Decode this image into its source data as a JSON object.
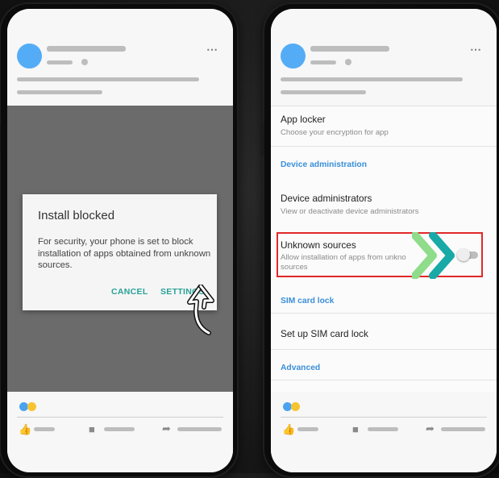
{
  "left_phone": {
    "more_icon": "⋯",
    "dialog": {
      "title": "Install blocked",
      "body": "For security, your phone is set to block installation of apps obtained from unknown sources.",
      "cancel_label": "CANCEL",
      "settings_label": "SETTINGS"
    }
  },
  "right_phone": {
    "more_icon": "⋯",
    "rows": {
      "app_locker_title": "App locker",
      "app_locker_sub": "Choose your encryption for app",
      "device_admin_section": "Device administration",
      "device_admins_title": "Device administrators",
      "device_admins_sub": "View or deactivate device administrators",
      "unknown_sources_title": "Unknown sources",
      "unknown_sources_sub1": "Allow installation of apps from unkno",
      "unknown_sources_sub2": "sources",
      "sim_section": "SIM card lock",
      "sim_title": "Set up SIM card lock",
      "advanced_section": "Advanced"
    },
    "unknown_sources_enabled": false
  },
  "icons": {
    "like": "thumbs-up-icon",
    "comment": "comment-icon",
    "share": "share-icon",
    "cursor": "hand-cursor-icon",
    "arrows": "double-chevron-arrow-icon"
  },
  "colors": {
    "avatar": "#54acf7",
    "accent_teal": "#2aa198",
    "section_blue": "#3a8fd8",
    "highlight_red": "#e22828",
    "reaction_blue": "#4aa3f0",
    "reaction_yellow": "#f7c431",
    "arrow_green": "#8fdc8a",
    "arrow_teal": "#19a9a6"
  }
}
